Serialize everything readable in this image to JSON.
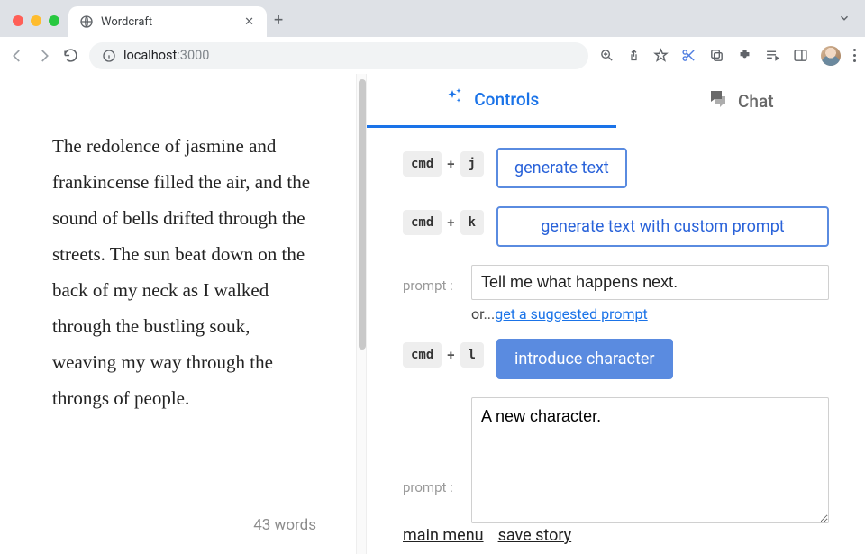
{
  "browser": {
    "tab_title": "Wordcraft",
    "url_host": "localhost",
    "url_port": ":3000"
  },
  "editor": {
    "text": " The redolence of jasmine and frankincense filled the air, and the sound of bells drifted through the streets. The sun beat down on the back of my neck as I walked through the bustling souk, weaving my way through the throngs of people.",
    "word_count": "43 words"
  },
  "panel": {
    "tabs": {
      "controls": "Controls",
      "chat": "Chat"
    },
    "actions": {
      "generate": {
        "mod": "cmd",
        "key": "j",
        "label": "generate text"
      },
      "generate_custom": {
        "mod": "cmd",
        "key": "k",
        "label": "generate text with custom prompt",
        "prompt_label": "prompt :",
        "prompt_value": "Tell me what happens next.",
        "hint_prefix": "or...",
        "hint_link": "get a suggested prompt"
      },
      "introduce": {
        "mod": "cmd",
        "key": "l",
        "label": "introduce character",
        "prompt_label": "prompt :",
        "prompt_value": "A new character."
      }
    },
    "footer": {
      "main_menu": "main menu",
      "save_story": "save story"
    }
  }
}
